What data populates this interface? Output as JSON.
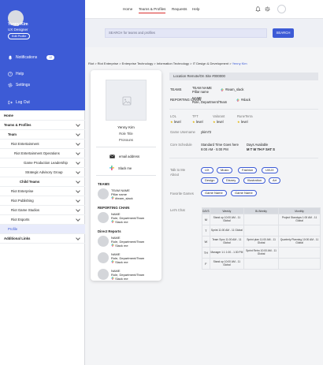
{
  "sidebar": {
    "user_name": "Yenny Kim",
    "user_title": "UX Designer",
    "edit_label": "Edit Profile",
    "notifications_label": "Notifications",
    "notifications_count": "12",
    "help_label": "Help",
    "settings_label": "Settings",
    "logout_label": "Log Out",
    "nav": [
      {
        "label": "Home"
      },
      {
        "label": "Teams & Profiles"
      },
      {
        "label": "Team"
      },
      {
        "label": "Riot Entertainment"
      },
      {
        "label": "Riot Entertainment Operations"
      },
      {
        "label": "Game Production Leadership"
      },
      {
        "label": "Strategic Advisory Group"
      },
      {
        "label": "Child Teams"
      },
      {
        "label": "Riot Enterprise"
      },
      {
        "label": "Riot Publishing"
      },
      {
        "label": "Riot Game Studios"
      },
      {
        "label": "Riot Esports"
      },
      {
        "label": "Profile"
      },
      {
        "label": "Additional Links"
      }
    ]
  },
  "topnav": {
    "items": [
      "Home",
      "Teams & Profiles",
      "Requests",
      "Help"
    ],
    "active": "Teams & Profiles"
  },
  "search": {
    "placeholder": "SEARCH for teams and profiles",
    "button": "SEARCH"
  },
  "breadcrumb": {
    "path": "Riot > Riot Enterprise > Enterprise Technology > Information Technology > IT Design & Development >",
    "current": "Yenny Kim"
  },
  "card": {
    "name": "Yenny Kim",
    "role_title": "Role Title",
    "pronouns": "Pronouns",
    "email": "email address",
    "slack": "Slack me",
    "teams_heading": "TEAMS",
    "team": {
      "name": "TEAM NAME",
      "sub": "Pillar name",
      "channel": "#team_slack"
    },
    "chain_heading": "REPORTING CHAIN",
    "chain": {
      "name": "NAME",
      "sub": "Role, Department/Team",
      "slack": "Slack me"
    },
    "reports_heading": "Direct Reports",
    "reports": [
      {
        "name": "NAME",
        "sub": "Role, Department/Team",
        "slack": "Slack me"
      },
      {
        "name": "NAME",
        "sub": "Role, Department/Team",
        "slack": "Slack me"
      },
      {
        "name": "NAME",
        "sub": "Role, Department/Team",
        "slack": "Slack me"
      }
    ]
  },
  "profile": {
    "location": "Location  Remote/On Site  #000000",
    "teams_label": "TEAMS",
    "team_name": "TEAM NAME",
    "team_pillar": "Pillar name",
    "team_channel": "#team_slack",
    "chain_label": "REPORTING CHAIN",
    "chain_name": "NAME",
    "chain_role": "Role, Department/Team",
    "chain_slack": "#slack",
    "ranks": [
      {
        "label": "LOL",
        "value": "level"
      },
      {
        "label": "TFT",
        "value": "level"
      },
      {
        "label": "Valorant",
        "value": "level"
      },
      {
        "label": "RuneTerra",
        "value": "level"
      }
    ],
    "game_username_label": "Game Username",
    "game_username": "ykim72",
    "core_schedule_label": "Core Schedule",
    "std_time_label": "Standard Time Goes here",
    "std_time": "9:00 AM - 5:00 PM",
    "days_label": "Days Available",
    "days": "M T W TH F SAT S",
    "talk_label": "Talk to Me About",
    "talk_tags": [
      "UX",
      "Music",
      "Fashion",
      "UI/UX",
      "Design",
      "Disney",
      "Illustration",
      "Art"
    ],
    "fav_games_label": "Favorite Games",
    "fav_games": [
      "Game Name",
      "Game Name"
    ],
    "lets_chat_label": "Let's Chat",
    "chat_table": {
      "headers": [
        "DAYS",
        "Weekly",
        "Bi-Weekly",
        "Monthly"
      ],
      "rows": [
        [
          "M",
          "Stand up 10:00 AM - 11 Global",
          "",
          "Project Standups 1:00 AM - 11 Global"
        ],
        [
          "T",
          "Sprint 11:00 AM - 11 Global",
          "",
          ""
        ],
        [
          "W",
          "Team Sync 11:00 AM - 11 Global",
          "Sprint plan 11:00 AM - 11 Global",
          "Quarterly Planning 10:00 AM - 11 Global"
        ],
        [
          "TH",
          "Manager 1:1 1:00 - 1:30 PM",
          "Sprint Retro 10:00 AM - 11 Global",
          ""
        ],
        [
          "F",
          "Stand up 10:00 AM - 11 Global",
          "",
          ""
        ]
      ]
    }
  },
  "colors": {
    "brand": "#3d5bd6",
    "accent_red": "#d93030",
    "star": "#e2b400"
  }
}
